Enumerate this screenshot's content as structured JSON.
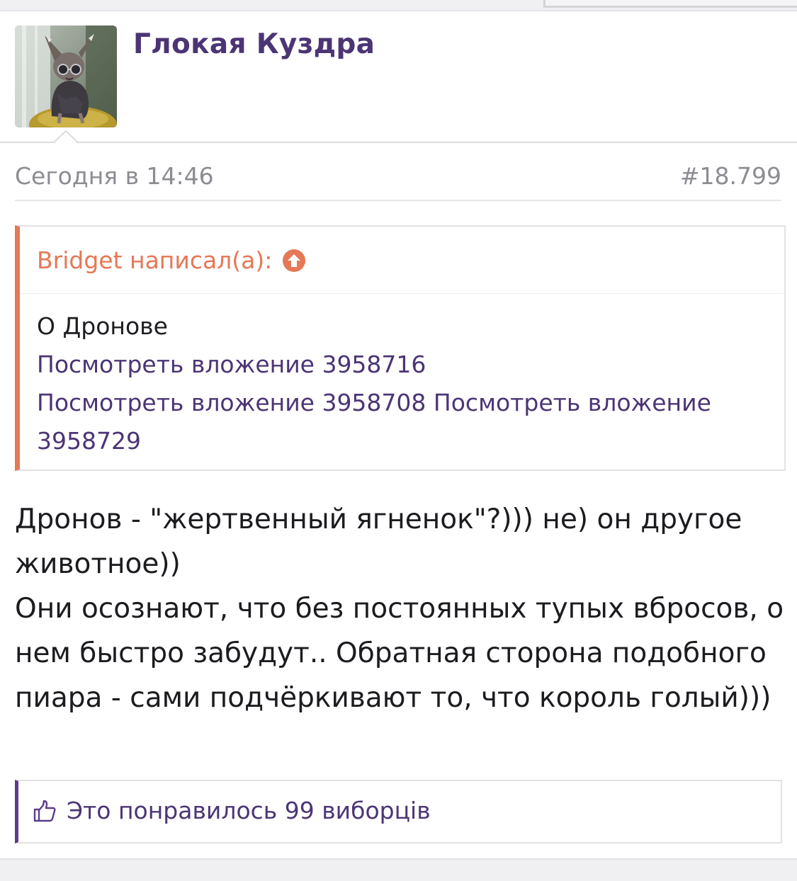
{
  "post": {
    "author": "Глокая Куздра",
    "date": "Сегодня в 14:46",
    "number": "#18.799",
    "avatar_icon": "sphynx-cat-avatar"
  },
  "quote": {
    "header": "Bridget написал(а):",
    "up_icon": "arrow-up-circle-icon",
    "text": "О Дронове",
    "attachments": [
      "Посмотреть вложение 3958716",
      "Посмотреть вложение 3958708",
      "Посмотреть вложение 3958729"
    ]
  },
  "message": {
    "lines": [
      "Дронов - \"жертвенный ягненок\"?))) не) он другое животное))",
      "Они осознают, что без постоянных тупых вбросов, о нем быстро забудут.. Обратная сторона подобного пиара - сами подчёркивают то, что король голый)))"
    ]
  },
  "likes": {
    "icon": "thumbs-up-icon",
    "text": "Это понравилось 99 виборців"
  },
  "colors": {
    "author": "#4b3575",
    "quote_accent": "#e57856",
    "link": "#4b3575",
    "likes_accent": "#5b3d8a",
    "muted": "#8c8c92"
  }
}
